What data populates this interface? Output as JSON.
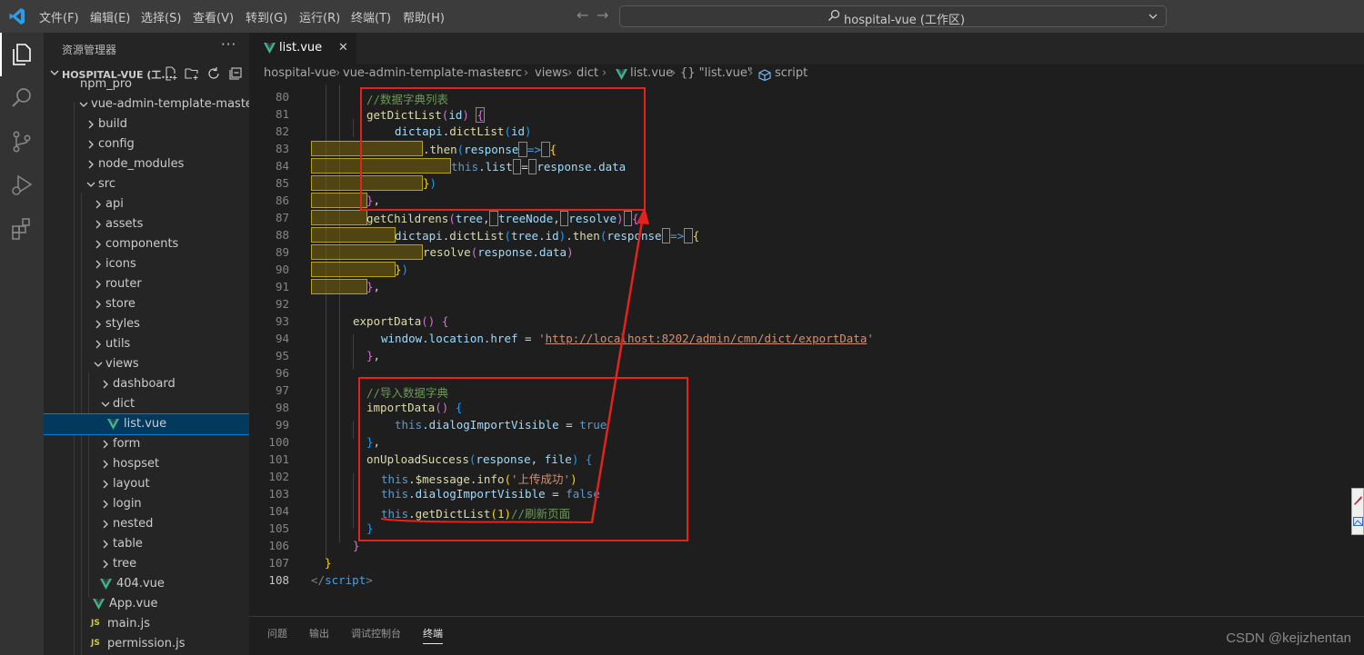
{
  "menu": [
    "文件(F)",
    "编辑(E)",
    "选择(S)",
    "查看(V)",
    "转到(G)",
    "运行(R)",
    "终端(T)",
    "帮助(H)"
  ],
  "command_center": {
    "text": "hospital-vue (工作区)"
  },
  "sidebar": {
    "title": "资源管理器",
    "more": "···",
    "workspace_label": "HOSPITAL-VUE (工...",
    "tree": [
      "npm_pro",
      "vue-admin-template-master",
      "build",
      "config",
      "node_modules",
      "src",
      "api",
      "assets",
      "components",
      "icons",
      "router",
      "store",
      "styles",
      "utils",
      "views",
      "dashboard",
      "dict",
      "list.vue",
      "form",
      "hospset",
      "layout",
      "login",
      "nested",
      "table",
      "tree",
      "404.vue",
      "App.vue",
      "main.js",
      "permission.js"
    ],
    "js_badge": "JS"
  },
  "tab": {
    "label": "list.vue",
    "close": "✕"
  },
  "breadcrumb": [
    "hospital-vue",
    "vue-admin-template-master",
    "src",
    "views",
    "dict",
    "list.vue",
    "{} \"list.vue\"",
    "script"
  ],
  "code": {
    "line_numbers": [
      "80",
      "81",
      "82",
      "83",
      "84",
      "85",
      "86",
      "87",
      "88",
      "89",
      "90",
      "91",
      "92",
      "93",
      "94",
      "95",
      "96",
      "97",
      "98",
      "99",
      "100",
      "101",
      "102",
      "103",
      "104",
      "105",
      "106",
      "107",
      "108"
    ],
    "active_line": "108",
    "l80": "//数据字典列表",
    "l81_fn": "getDictList",
    "l81_param": "id",
    "l82_obj": "dictapi",
    "l82_fn": "dictList",
    "l82_arg": "id",
    "l83_fn": ".then",
    "l83_param": "response",
    "l83_arrow": "=>",
    "l84_this": "this",
    "l84_prop": ".list",
    "l84_eq": "=",
    "l84_val": "response.data",
    "l87_fn": "getChildrens",
    "l87_p1": "tree",
    "l87_p2": "treeNode",
    "l87_p3": "resolve",
    "l88_obj": "dictapi",
    "l88_fn": "dictList",
    "l88_arg": "tree.id",
    "l88_then": "then",
    "l88_param": "respons",
    "l88_param_end": "e",
    "l88_arrow": "=>",
    "l89_fn": "resolve",
    "l89_arg": "response.data",
    "l93_fn": "exportData",
    "l94_a": "window.location.href",
    "l94_eq": "=",
    "l94_url": "http://localhost:8202/admin/cmn/dict/exportData",
    "l97": "//导入数据字典",
    "l98_fn": "importData",
    "l99_this": "this",
    "l99_prop": ".dialogImportVisible",
    "l99_eq": "=",
    "l99_val": "true",
    "l101_fn": "onUploadSuccess",
    "l101_p1": "response",
    "l101_p2": "file",
    "l102_this": "this",
    "l102_fn": ".$message.info",
    "l102_str": "'上传成功'",
    "l103_this": "this",
    "l103_prop": ".dialogImportVisible",
    "l103_eq": "=",
    "l103_val": "false",
    "l104_this": "this",
    "l104_fn": ".getDictList",
    "l104_arg": "1",
    "l104_cmt": "//刷新页面",
    "l108_tag": "script"
  },
  "panel": {
    "tabs": [
      "问题",
      "输出",
      "调试控制台",
      "终端"
    ],
    "active": "终端"
  },
  "watermark": "CSDN @kejizhentan",
  "colors": {
    "annotation": "#e5231c",
    "selection": "#04395e",
    "titlebar": "#3c3c3c"
  },
  "icons": [
    "vscode-logo-icon",
    "explorer-icon",
    "search-icon",
    "source-control-icon",
    "run-debug-icon",
    "extensions-icon",
    "new-file-icon",
    "new-folder-icon",
    "refresh-icon",
    "collapse-all-icon",
    "vue-file-icon",
    "js-file-icon",
    "chevron-right-icon",
    "chevron-down-icon"
  ]
}
